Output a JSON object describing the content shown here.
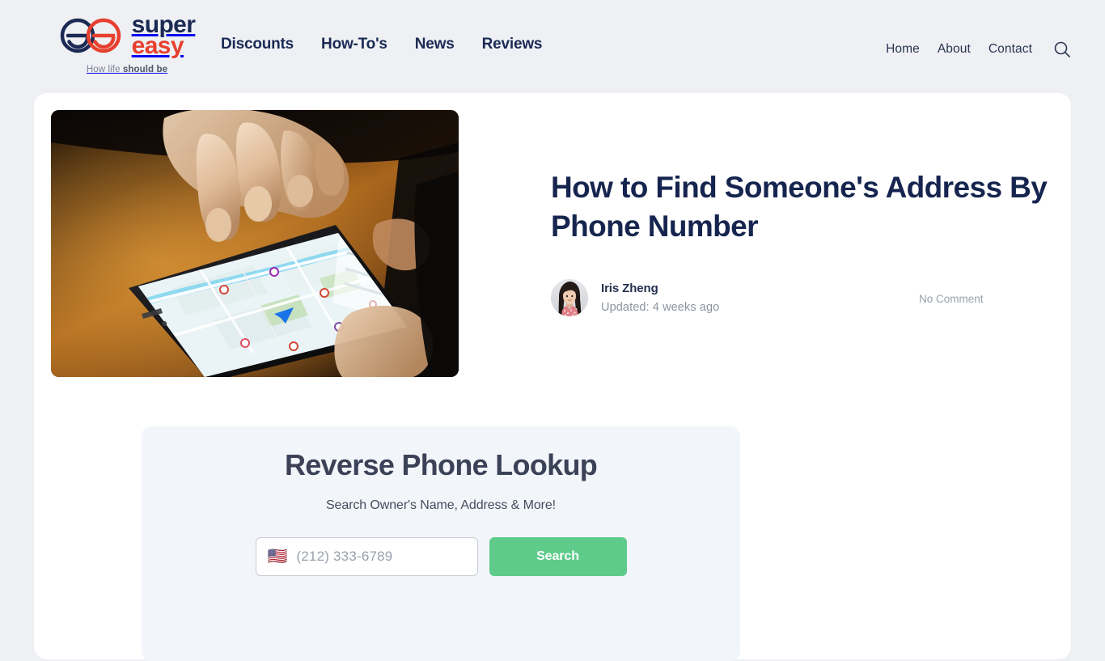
{
  "brand": {
    "name_line1": "super",
    "name_line2": "easy",
    "tagline_plain": "How life ",
    "tagline_bold": "should be",
    "logo_icon": "superreasy-double-e-logo",
    "navy": "#1b2a54",
    "red": "#e8402f"
  },
  "nav": {
    "primary": [
      {
        "label": "Discounts"
      },
      {
        "label": "How-To's"
      },
      {
        "label": "News"
      },
      {
        "label": "Reviews"
      }
    ],
    "utility": [
      {
        "label": "Home"
      },
      {
        "label": "About"
      },
      {
        "label": "Contact"
      }
    ],
    "search_icon": "search-icon"
  },
  "article": {
    "title": "How to Find Someone's Address By Phone Number",
    "hero_image_alt": "hand-tapping-smartphone-showing-map",
    "author": "Iris Zheng",
    "updated": "Updated: 4 weeks ago",
    "comments": "No Comment"
  },
  "lookup": {
    "title": "Reverse Phone Lookup",
    "subtitle": "Search Owner's Name, Address & More!",
    "country_flag": "🇺🇸",
    "phone_placeholder": "(212) 333-6789",
    "phone_value": "",
    "submit_label": "Search",
    "submit_color": "#5ecb8b"
  },
  "theme": {
    "page_background": "#eef0f4",
    "card_background": "#ffffff",
    "widget_background": "#f2f6fa"
  }
}
